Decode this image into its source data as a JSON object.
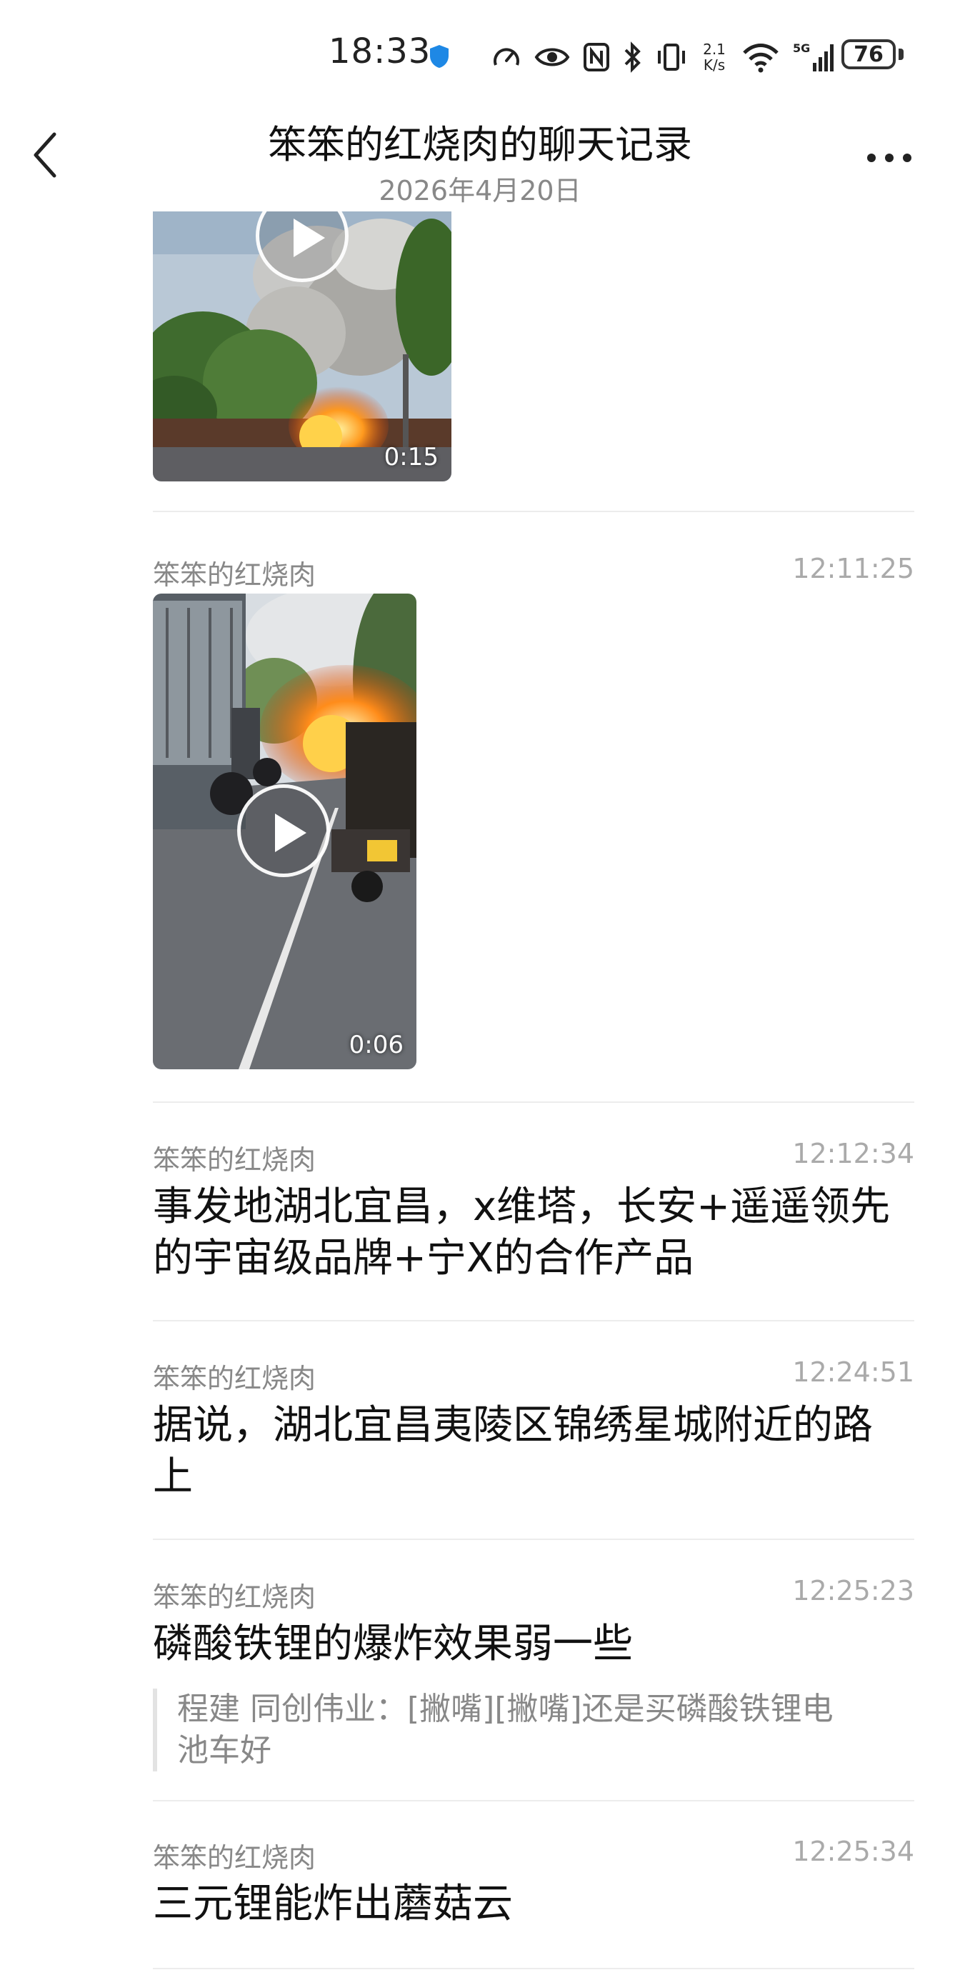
{
  "status_bar": {
    "time": "18:33",
    "net_speed_value": "2.1",
    "net_speed_unit": "K/s",
    "battery": "76"
  },
  "header": {
    "title": "笨笨的红烧肉的聊天记录",
    "subtitle": "2026年4月20日"
  },
  "messages": [
    {
      "type": "video",
      "duration": "0:15"
    },
    {
      "type": "video",
      "sender": "笨笨的红烧肉",
      "time": "12:11:25",
      "duration": "0:06"
    },
    {
      "type": "text",
      "sender": "笨笨的红烧肉",
      "time": "12:12:34",
      "lines": [
        "事发地湖北宜昌，x维塔，长安+遥遥领先",
        "的宇宙级品牌+宁X的合作产品"
      ]
    },
    {
      "type": "text",
      "sender": "笨笨的红烧肉",
      "time": "12:24:51",
      "lines": [
        "据说，湖北宜昌夷陵区锦绣星城附近的路",
        "上"
      ]
    },
    {
      "type": "text",
      "sender": "笨笨的红烧肉",
      "time": "12:25:23",
      "lines": [
        "磷酸铁锂的爆炸效果弱一些"
      ],
      "quote_lines": [
        "程建 同创伟业：[撇嘴][撇嘴]还是买磷酸铁锂电",
        "池车好"
      ]
    },
    {
      "type": "text",
      "sender": "笨笨的红烧肉",
      "time": "12:25:34",
      "lines": [
        "三元锂能炸出蘑菇云"
      ]
    }
  ]
}
